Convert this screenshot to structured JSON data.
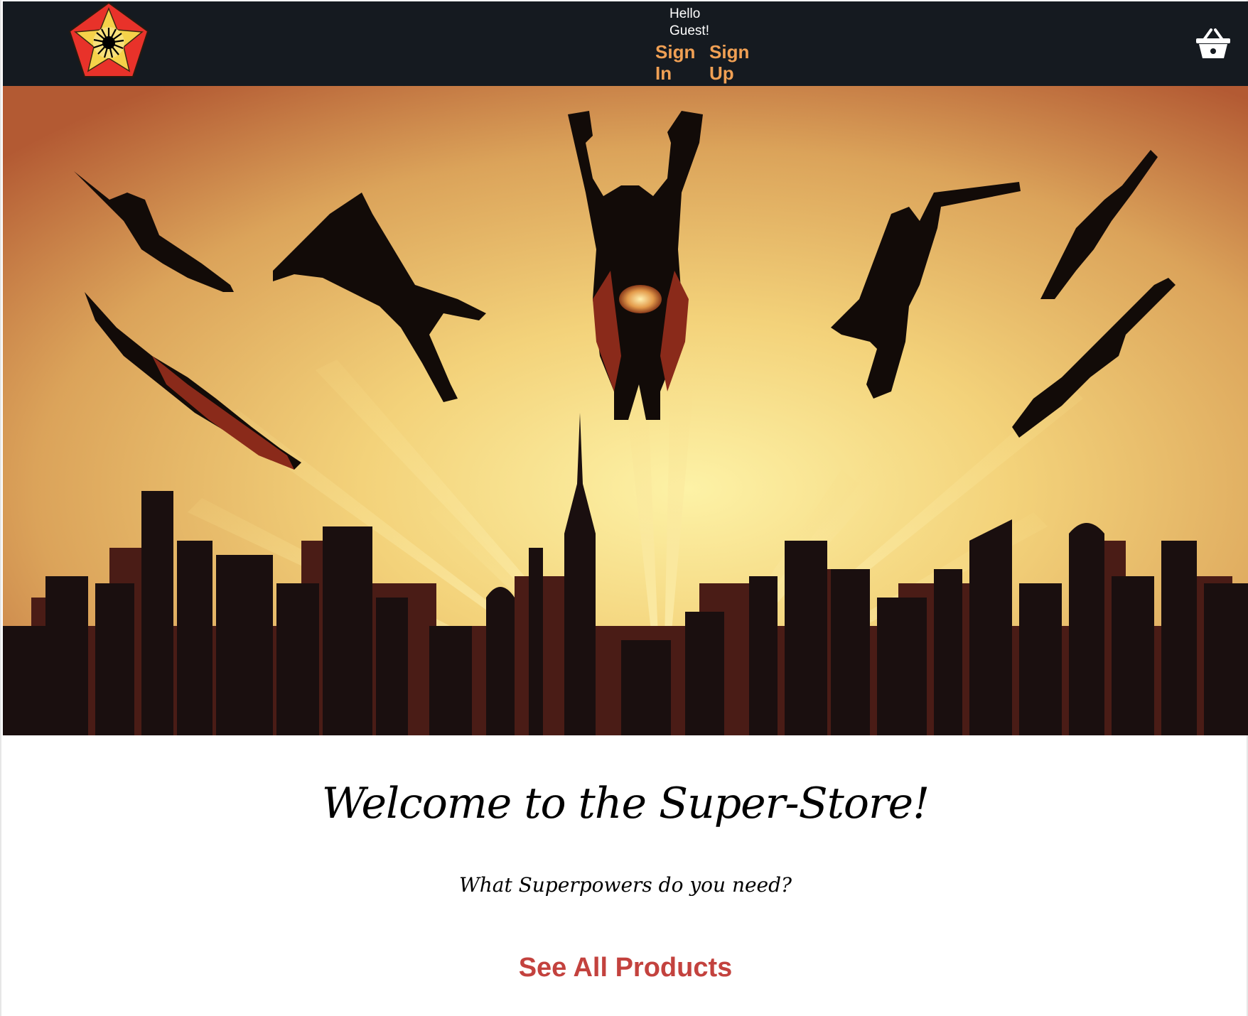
{
  "header": {
    "logo_icon": "superhero-pentagon-logo-icon",
    "greeting": "Hello Guest!",
    "sign_in_label": "Sign In",
    "sign_up_label": "Sign Up",
    "cart_icon": "shopping-basket-icon",
    "link_color": "#f0a054",
    "background_color": "#151a20"
  },
  "hero": {
    "image": "flying-superheroes-over-city-skyline-illustration"
  },
  "main": {
    "title": "Welcome to the Super-Store!",
    "subtitle": "What Superpowers do you need?",
    "cta_label": "See All Products",
    "cta_color": "#c3423e"
  }
}
